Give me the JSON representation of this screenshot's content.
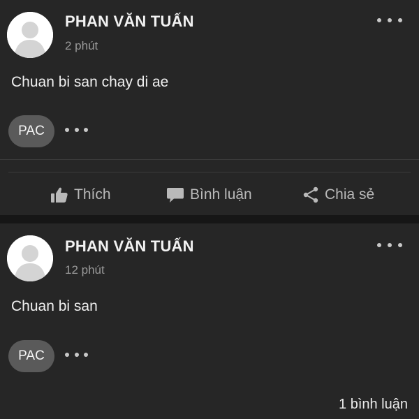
{
  "posts": [
    {
      "author": "PHAN VĂN TUẤN",
      "time": "2 phút",
      "content": "Chuan bi san chay di ae",
      "tag": "PAC"
    },
    {
      "author": "PHAN VĂN TUẤN",
      "time": "12 phút",
      "content": "Chuan bi san",
      "tag": "PAC",
      "comments_count": "1 bình luận"
    }
  ],
  "actions": {
    "like_label": "Thích",
    "comment_label": "Bình luận",
    "share_label": "Chia sẻ"
  },
  "colors": {
    "background": "#161616",
    "card": "#262626",
    "text": "#ececec",
    "muted": "#9a9a9a",
    "chip": "#5a5a5a"
  },
  "icons": [
    "more-options-icon",
    "avatar-placeholder-icon",
    "thumbs-up-icon",
    "comment-bubble-icon",
    "share-icon",
    "ellipsis-icon"
  ]
}
